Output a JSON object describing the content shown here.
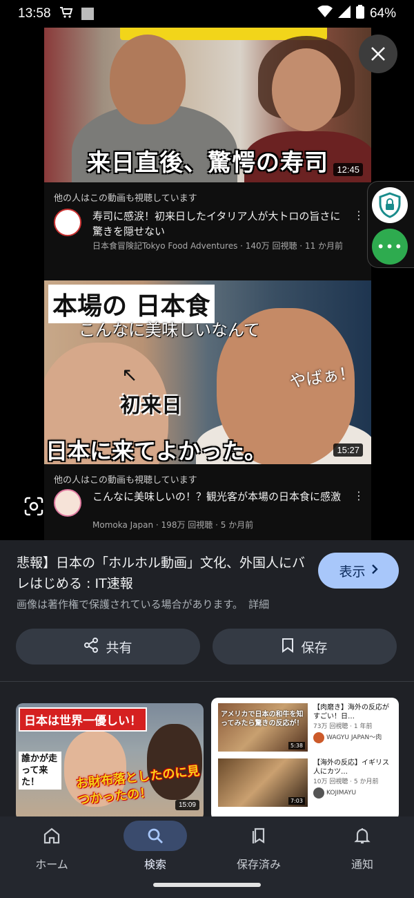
{
  "status_bar": {
    "time": "13:58",
    "battery": "64%"
  },
  "viewer": {
    "video1": {
      "caption": "来日直後、驚愕の寿司",
      "duration": "12:45"
    },
    "rec1": {
      "label": "他の人はこの動画も視聴しています",
      "title": "寿司に感涙！初来日したイタリア人が大トロの旨さに驚きを隠せない",
      "meta": "日本食冒険記Tokyo Food Adventures · 140万 回視聴 · 11 か月前"
    },
    "video2": {
      "line1": "本場の 日本食",
      "line2": "こんなに美味しいなんて",
      "line3": "初来日",
      "line4": "やばぁ！",
      "line5": "日本に来てよかった。",
      "duration": "15:27"
    },
    "rec2": {
      "label": "他の人はこの動画も視聴しています",
      "title": "こんなに美味しいの！？観光客が本場の日本食に感激",
      "meta": "Momoka Japan · 198万 回視聴 · 5 か月前"
    }
  },
  "panel": {
    "source_title": "悲報】日本の「ホルホル動画」文化、外国人にバレはじめる : IT速報",
    "view_button": "表示",
    "copyright": "画像は著作権で保護されている場合があります。",
    "detail_link": "詳細",
    "share_button": "共有",
    "save_button": "保存"
  },
  "related": {
    "card1": {
      "banner": "日本は世界一優しい！",
      "side_text": "誰かが走って来た！",
      "main_text": "お財布落としたのに見つかったの！",
      "duration": "15:09"
    },
    "card2": {
      "item1": {
        "thumb_text": "アメリカで日本の和牛を知ってみたら驚きの反応が！",
        "duration": "5:38",
        "title": "【肉磨き】海外の反応がすごい！日…",
        "meta": "73万 回視聴 · 1 年前",
        "channel": "WAGYU JAPAN〜肉"
      },
      "item2": {
        "duration": "7:03",
        "title": "【海外の反応】イギリス人にカツ…",
        "meta": "10万 回視聴 · 5 か月前",
        "channel": "KOJIMAYU"
      }
    }
  },
  "nav": {
    "items": [
      {
        "label": "ホーム",
        "icon": "home-icon"
      },
      {
        "label": "検索",
        "icon": "search-icon"
      },
      {
        "label": "保存済み",
        "icon": "saved-icon"
      },
      {
        "label": "通知",
        "icon": "bell-icon"
      }
    ],
    "active": "検索"
  },
  "colors": {
    "panel_bg": "#1f2126",
    "view_button_bg": "#a8c7fa",
    "action_button_bg": "#343a44",
    "nav_active_pill": "#3a4b6d",
    "green_fab": "#2eab4f"
  }
}
